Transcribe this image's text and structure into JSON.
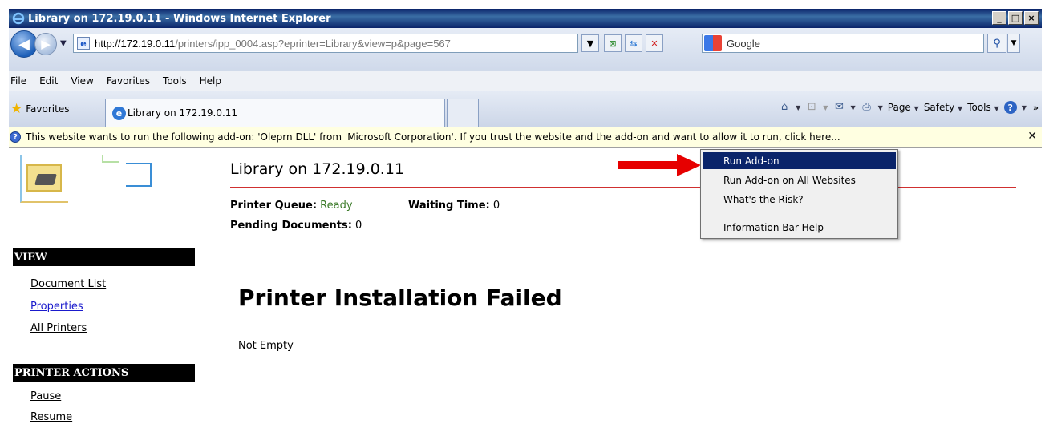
{
  "window": {
    "title": "Library on 172.19.0.11 - Windows Internet Explorer",
    "minimize_glyph": "_",
    "maximize_glyph": "□",
    "close_glyph": "×"
  },
  "address_bar": {
    "url_host": "http://172.19.0.11",
    "url_path": "/printers/ipp_0004.asp?eprinter=Library&view=p&page=567"
  },
  "search": {
    "placeholder": "Google"
  },
  "menu": [
    "File",
    "Edit",
    "View",
    "Favorites",
    "Tools",
    "Help"
  ],
  "favorites_bar": {
    "favorites_label": "Favorites",
    "tab_label": "Library on 172.19.0.11"
  },
  "command_bar": {
    "page_label": "Page",
    "safety_label": "Safety",
    "tools_label": "Tools",
    "more_glyph": "»"
  },
  "info_bar": {
    "message": "This website wants to run the following add-on: 'Oleprn DLL' from 'Microsoft Corporation'. If you trust the website and the add-on and want to allow it to run, click here..."
  },
  "page": {
    "title": "Library on 172.19.0.11",
    "queue_label": "Printer Queue:",
    "queue_value": "Ready",
    "waiting_label": "Waiting Time:",
    "waiting_value": "0",
    "pending_label": "Pending Documents:",
    "pending_value": "0",
    "heading": "Printer Installation Failed",
    "message": "Not Empty"
  },
  "sidebar": {
    "view_header": "VIEW",
    "view_links": [
      "Document List",
      "Properties",
      "All Printers"
    ],
    "actions_header": "PRINTER ACTIONS",
    "action_links": [
      "Pause",
      "Resume"
    ]
  },
  "context_menu": {
    "items": [
      "Run Add-on",
      "Run Add-on on All Websites",
      "What's the Risk?"
    ],
    "help_item": "Information Bar Help"
  },
  "colors": {
    "titlebar": "#0a246a",
    "infobar": "#ffffe1",
    "rule": "#d03030",
    "ready": "#3c7b2a",
    "arrow": "#e60000"
  }
}
